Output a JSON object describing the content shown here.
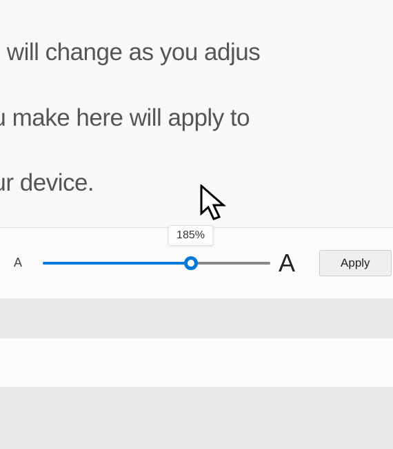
{
  "description": {
    "line1": "rds will change as you adjus",
    "line2": "you make here will apply to",
    "line3": "your device."
  },
  "slider": {
    "letter_small": "A",
    "letter_large": "A",
    "value_percent": "185%",
    "position_pct": 65
  },
  "apply_label": "Apply"
}
